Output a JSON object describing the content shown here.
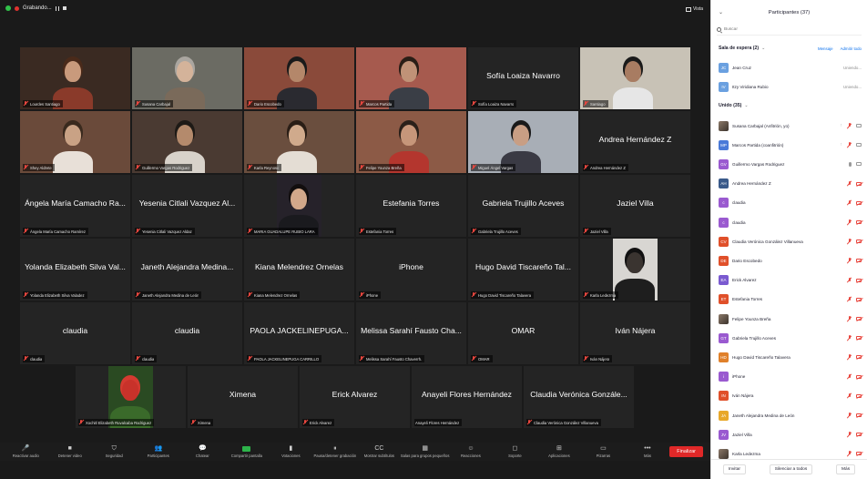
{
  "window": {
    "recording_label": "Grabando...",
    "view_label": "Vista"
  },
  "tiles": [
    {
      "name": "Lourdes Santiago",
      "video": true,
      "bg": "#3a2a22",
      "skin": "#c99a7c",
      "shirt": "#8a3a2a",
      "hair": "#4a2a1a"
    },
    {
      "name": "Susana Carbajal",
      "video": true,
      "bg": "#6b6b63",
      "skin": "#d4b39a",
      "shirt": "#7a6a5a",
      "hair": "#aaa6a0"
    },
    {
      "name": "Dario Escobedo",
      "video": true,
      "bg": "#8a4a3a",
      "skin": "#b4876a",
      "shirt": "#2a2a30",
      "hair": "#1a1a1a"
    },
    {
      "name": "Marcos Partida",
      "video": true,
      "bg": "#a65a4e",
      "skin": "#c09277",
      "shirt": "#3a3e46",
      "hair": "#2a1e16"
    },
    {
      "name": "Sofía Loaiza Navarro",
      "video": false
    },
    {
      "name": "Santiago",
      "video": true,
      "bg": "#c8c2b6",
      "skin": "#a87c62",
      "shirt": "#e6e6e6",
      "hair": "#1a1a1a"
    },
    {
      "name": "Shey Aldrete",
      "video": true,
      "bg": "#6a4a3a",
      "skin": "#c9a285",
      "shirt": "#e8e0d8",
      "hair": "#3a2a1e"
    },
    {
      "name": "Guillermo Vargas Rodriguez",
      "video": true,
      "active": true,
      "bg": "#4a3a32",
      "skin": "#b48a6c",
      "shirt": "#d8d2ca",
      "hair": "#1e1a16"
    },
    {
      "name": "Karla Reynoso",
      "video": true,
      "bg": "#6a4e3e",
      "skin": "#d0aa8c",
      "shirt": "#e4ddd4",
      "hair": "#2a1e16"
    },
    {
      "name": "Felipe Younza Breña",
      "video": true,
      "bg": "#8c5a46",
      "skin": "#c6967a",
      "shirt": "#b4362e",
      "hair": "#2a201a"
    },
    {
      "name": "Miguel Ángel Vargas",
      "video": true,
      "bg": "#a8aeb6",
      "skin": "#c89e84",
      "shirt": "#3a3a44",
      "hair": "#1a1a1a"
    },
    {
      "name": "Andrea Hernández Z",
      "video": false
    },
    {
      "name": "Ángela María Camacho Ramírez",
      "display": "Ángela María Camacho Ra...",
      "video": false
    },
    {
      "name": "Yesenia Citlali Vazquez Aldaz",
      "display": "Yesenia Citlali Vazquez Al...",
      "video": false
    },
    {
      "name": "MARIA GUADALUPE RUBIO LARA",
      "video": true,
      "bg": "#26222a",
      "skin": "#d2a88a",
      "shirt": "#1a1a1e",
      "hair": "#120e0e",
      "pic": true
    },
    {
      "name": "Estefania Torres",
      "video": false
    },
    {
      "name": "Gabriela Trujillo Aceves",
      "video": false
    },
    {
      "name": "Jaziel Villa",
      "video": false
    },
    {
      "name": "Yolanda Elizabeth Silva Valadez",
      "display": "Yolanda Elizabeth Silva Val...",
      "video": false
    },
    {
      "name": "Janeth Alejandra Medina de León",
      "display": "Janeth Alejandra Medina...",
      "video": false
    },
    {
      "name": "Kiana Melendrez Ornelas",
      "video": false
    },
    {
      "name": "iPhone",
      "video": false
    },
    {
      "name": "Hugo David Tiscareño Talavera",
      "display": "Hugo David Tiscareño Tal...",
      "video": false
    },
    {
      "name": "Karla Ledezma",
      "video": true,
      "bg": "#d8d6d2",
      "skin": "#3a3430",
      "shirt": "#1e1e1e",
      "hair": "#111111",
      "pic": true
    },
    {
      "name": "claudia",
      "video": false
    },
    {
      "name": "claudia",
      "video": false
    },
    {
      "name": "PAOLA JACKELINEPUGA CARRILLO",
      "display": "PAOLA JACKELINEPUGA...",
      "video": false
    },
    {
      "name": "Melissa Sarahí Fausto Chaverrh.",
      "display": "Melissa Sarahí Fausto Cha...",
      "video": false
    },
    {
      "name": "OMAR",
      "video": false
    },
    {
      "name": "Iván Nájera",
      "video": false
    },
    {
      "name": "Xochitl Elizabeth Ruvalcaba Rodriguez",
      "video": true,
      "bg": "#2a4a22",
      "skin": "#c8322a",
      "shirt": "#3a6a2a",
      "hair": "#d43a30",
      "pic": true
    },
    {
      "name": "Ximena",
      "video": false
    },
    {
      "name": "Erick Alvarez",
      "video": false
    },
    {
      "name": "Anayeli Flores Hernández",
      "video": false
    },
    {
      "name": "Claudia Verónica González Villanueva",
      "display": "Claudia Verónica Gonzále...",
      "video": false
    }
  ],
  "toolbar": [
    {
      "id": "audio",
      "label": "Reactivar audio",
      "icon": "🎤"
    },
    {
      "id": "video",
      "label": "Detener video",
      "icon": "■"
    },
    {
      "id": "security",
      "label": "Seguridad",
      "icon": "⛉"
    },
    {
      "id": "participants",
      "label": "Participantes",
      "icon": "👥"
    },
    {
      "id": "chat",
      "label": "Chatear",
      "icon": "💬"
    },
    {
      "id": "share",
      "label": "Compartir pantalla",
      "icon": "green",
      "green": true
    },
    {
      "id": "polls",
      "label": "Votaciones",
      "icon": "▮"
    },
    {
      "id": "record",
      "label": "Pausa/detener grabación",
      "icon": "⏸"
    },
    {
      "id": "subtitles",
      "label": "Mostrar subtítulos",
      "icon": "CC"
    },
    {
      "id": "rooms",
      "label": "Salas para grupos pequeños",
      "icon": "▦"
    },
    {
      "id": "reactions",
      "label": "Reacciones",
      "icon": "☺"
    },
    {
      "id": "support",
      "label": "Soporte",
      "icon": "◻"
    },
    {
      "id": "apps",
      "label": "Aplicaciones",
      "icon": "⊞"
    },
    {
      "id": "whiteboards",
      "label": "Pizarras",
      "icon": "▭"
    },
    {
      "id": "more",
      "label": "Más",
      "icon": "•••"
    }
  ],
  "end_button": "Finalizar",
  "panel": {
    "title": "Participantes (37)",
    "search_placeholder": "Buscar",
    "waiting_header": "Sala de espera (2)",
    "waiting_links": [
      "Mensaje",
      "Admitir todo"
    ],
    "waiting": [
      {
        "initials": "JC",
        "name": "Jean Cruz",
        "status": "Uniendo...",
        "color": "#6aa0e0"
      },
      {
        "initials": "IV",
        "name": "Itzy Viridiana Rubio",
        "status": "Uniendo...",
        "color": "#6aa0e0"
      }
    ],
    "joined_header": "Unido (35)",
    "joined": [
      {
        "initials": "SC",
        "name": "Susana Carbajal (Anfitrión, yo)",
        "color": "#9a9a9a",
        "photo": true,
        "state": "host"
      },
      {
        "initials": "MP",
        "name": "Marcos Partida (coanfitrión)",
        "color": "#4a7ad8",
        "state": "cohost"
      },
      {
        "initials": "GV",
        "name": "Guillermo Vargas Rodriguez",
        "color": "#9a5ad0",
        "state": "speaking"
      },
      {
        "initials": "AH",
        "name": "Andrea Hernández Z",
        "color": "#3a5a8a",
        "state": "muted"
      },
      {
        "initials": "c",
        "name": "claudia",
        "color": "#9a5ad0",
        "state": "muted"
      },
      {
        "initials": "c",
        "name": "claudia",
        "color": "#9a5ad0",
        "state": "muted"
      },
      {
        "initials": "CV",
        "name": "Claudia Verónica González Villanueva",
        "color": "#e0502a",
        "state": "muted"
      },
      {
        "initials": "DE",
        "name": "Dario Escobedo",
        "color": "#e0502a",
        "state": "muted"
      },
      {
        "initials": "EA",
        "name": "Erick Alvarez",
        "color": "#7a5ad0",
        "state": "muted"
      },
      {
        "initials": "ET",
        "name": "Estefania Torres",
        "color": "#e0502a",
        "state": "muted"
      },
      {
        "initials": "FY",
        "name": "Felipe Younza Breña",
        "color": "#8a5a3a",
        "photo": true,
        "state": "muted"
      },
      {
        "initials": "GT",
        "name": "Gabriela Trujillo Aceves",
        "color": "#9a5ad0",
        "state": "muted"
      },
      {
        "initials": "HD",
        "name": "Hugo David Tiscareño Talavera",
        "color": "#e0802a",
        "state": "muted"
      },
      {
        "initials": "i",
        "name": "iPhone",
        "color": "#9a5ad0",
        "state": "muted"
      },
      {
        "initials": "IN",
        "name": "Iván Nájera",
        "color": "#e0502a",
        "state": "muted"
      },
      {
        "initials": "JA",
        "name": "Janeth Alejandra Medina de León",
        "color": "#e8a82a",
        "state": "muted"
      },
      {
        "initials": "JV",
        "name": "Jaziel Villa",
        "color": "#9a5ad0",
        "state": "muted"
      },
      {
        "initials": "KL",
        "name": "Karla Ledezma",
        "color": "#5a5a5a",
        "photo": true,
        "state": "muted"
      }
    ],
    "bottom": [
      "Invitar",
      "Silenciar a todos",
      "Más"
    ]
  }
}
